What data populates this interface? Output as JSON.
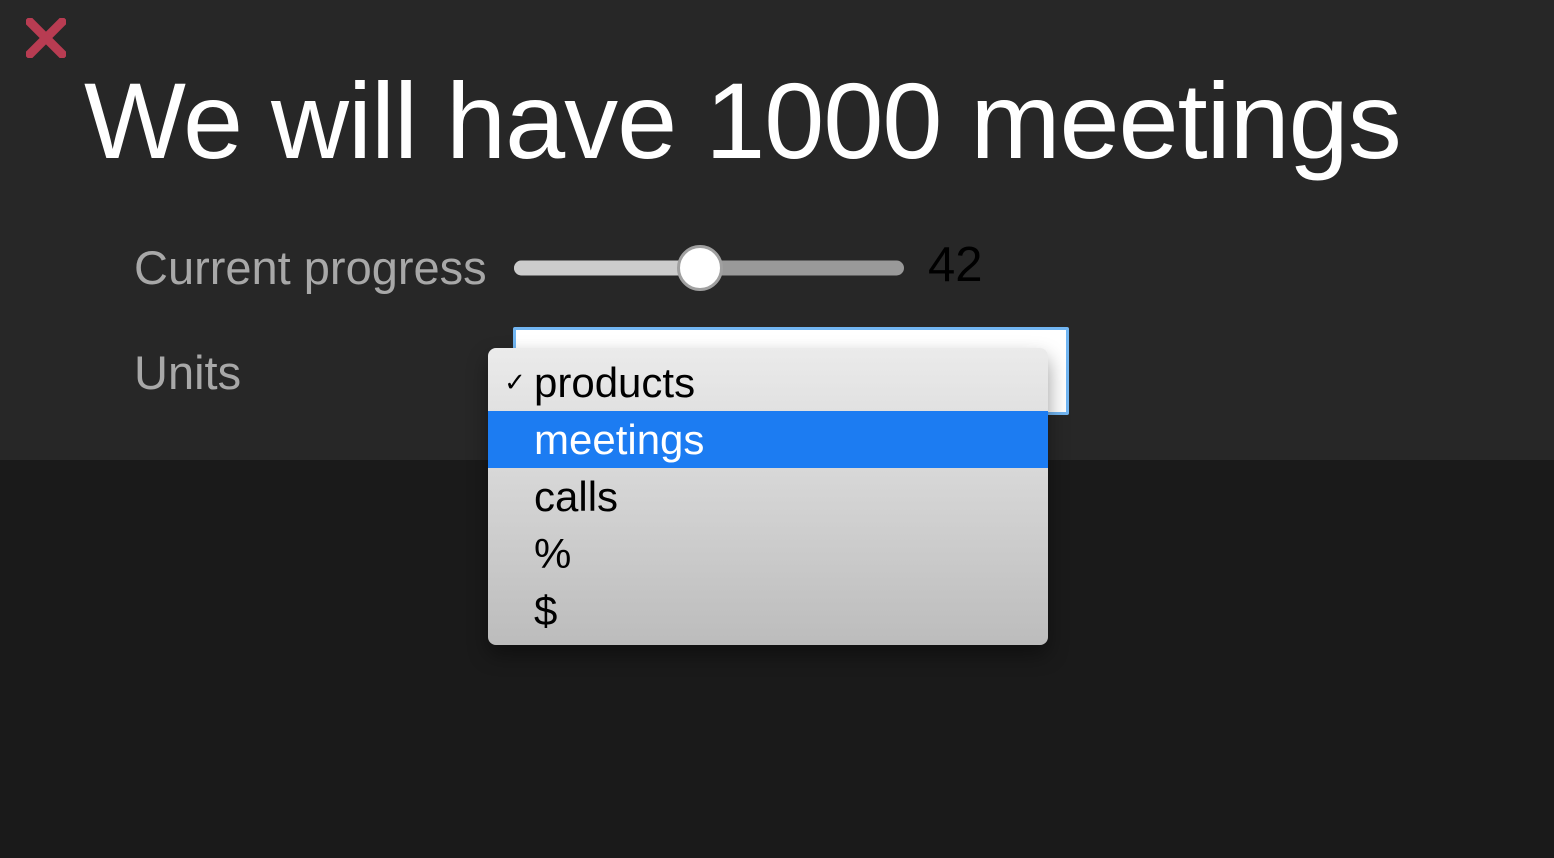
{
  "title": "We will have 1000 meetings",
  "form": {
    "progress_label": "Current progress",
    "progress_value": "42",
    "progress_percent": 42,
    "units_label": "Units"
  },
  "dropdown": {
    "selected_index": 0,
    "highlighted_index": 1,
    "options": [
      {
        "label": "products"
      },
      {
        "label": "meetings"
      },
      {
        "label": "calls"
      },
      {
        "label": "%"
      },
      {
        "label": "$"
      }
    ]
  },
  "icons": {
    "close": "close-icon",
    "check": "✓"
  },
  "colors": {
    "bg": "#1a1a1a",
    "panel": "#272727",
    "close": "#b83c52",
    "highlight": "#1c7cf2",
    "select_border": "#72b6f2"
  }
}
